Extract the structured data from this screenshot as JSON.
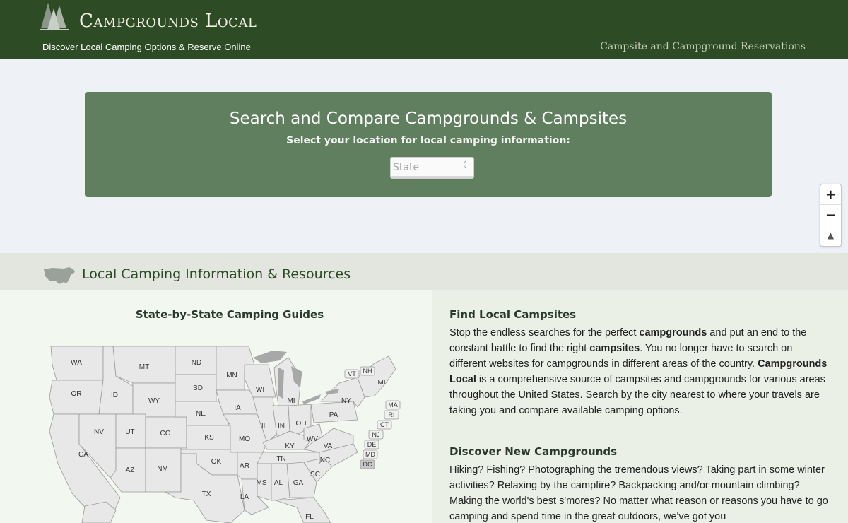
{
  "header": {
    "logo_text": "Campgrounds Local",
    "tagline": "Discover Local Camping Options & Reserve Online",
    "right_text": "Campsite and Campground Reservations"
  },
  "search": {
    "title": "Search and Compare Campgrounds & Campsites",
    "subtitle": "Select your location for local camping information:",
    "state_placeholder": "State"
  },
  "zoom": {
    "in": "+",
    "out": "−",
    "reset": "▲"
  },
  "resources": {
    "title": "Local Camping Information & Resources"
  },
  "guides": {
    "title": "State-by-State Camping Guides",
    "states": [
      "WA",
      "OR",
      "CA",
      "ID",
      "NV",
      "MT",
      "WY",
      "UT",
      "AZ",
      "CO",
      "NM",
      "ND",
      "SD",
      "NE",
      "KS",
      "OK",
      "TX",
      "MN",
      "IA",
      "MO",
      "AR",
      "LA",
      "WI",
      "IL",
      "MI",
      "IN",
      "KY",
      "TN",
      "MS",
      "AL",
      "OH",
      "WV",
      "VA",
      "NC",
      "SC",
      "GA",
      "FL",
      "PA",
      "NY",
      "ME",
      "VT",
      "NH",
      "MA",
      "RI",
      "CT",
      "NJ",
      "DE",
      "MD",
      "DC"
    ]
  },
  "find": {
    "title": "Find Local Campsites",
    "p1_a": "Stop the endless searches for the perfect ",
    "p1_b": "campgrounds",
    "p1_c": " and put an end to the constant battle to find the right ",
    "p1_d": "campsites",
    "p1_e": ". You no longer have to search on different websites for campgrounds in different areas of the country. ",
    "p1_f": "Campgrounds Local",
    "p1_g": " is a comprehensive source of campsites and campgrounds for various areas throughout the United States. Search by the city nearest to where your travels are taking you and compare available camping options."
  },
  "discover": {
    "title": "Discover New Campgrounds",
    "body": "Hiking? Fishing? Photographing the tremendous views? Taking part in some winter activities? Relaxing by the campfire? Backpacking and/or mountain climbing? Making the world's best s'mores? No matter what reason or reasons you have to go camping and spend time in the great outdoors, we've got you"
  }
}
